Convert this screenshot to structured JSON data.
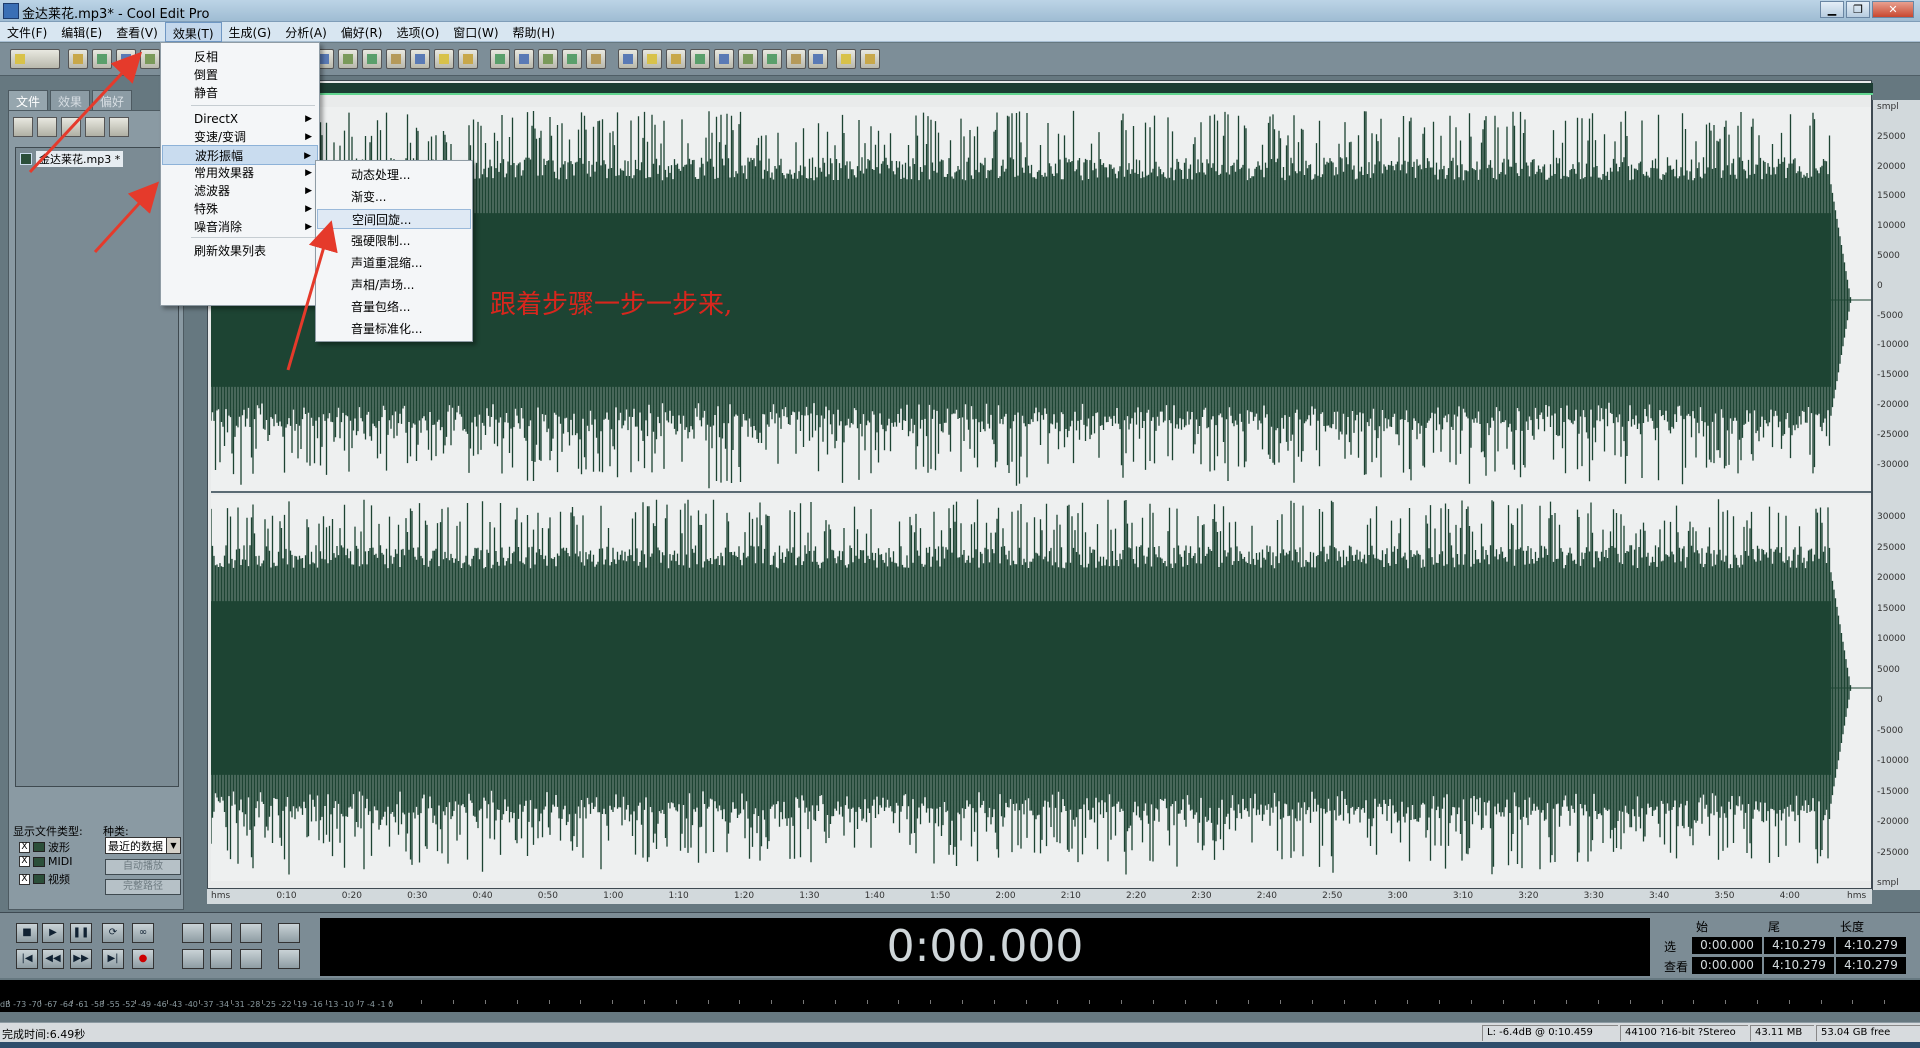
{
  "window": {
    "title": "金达莱花.mp3* - Cool Edit Pro",
    "controls": [
      "▁",
      "❐",
      "✕"
    ]
  },
  "menubar": [
    "文件(F)",
    "编辑(E)",
    "查看(V)",
    "效果(T)",
    "生成(G)",
    "分析(A)",
    "偏好(R)",
    "选项(O)",
    "窗口(W)",
    "帮助(H)"
  ],
  "left": {
    "tabs": [
      "文件",
      "效果",
      "偏好"
    ],
    "file": "金达莱花.mp3 *",
    "types_label": "显示文件类型:",
    "sort_label": "种类:",
    "types": [
      {
        "mark": "X",
        "label": "波形"
      },
      {
        "mark": "X",
        "label": "MIDI"
      },
      {
        "mark": "X",
        "label": "视频"
      }
    ],
    "sort_value": "最近的数据",
    "btn_autoplay": "自动播放",
    "btn_fullpath": "完整路径"
  },
  "effects_menu": {
    "items": [
      "反相",
      "倒置",
      "静音",
      "DirectX",
      "变速/变调",
      "波形振幅",
      "常用效果器",
      "滤波器",
      "特殊",
      "噪音消除",
      "刷新效果列表"
    ],
    "submenu_arrows": "▶"
  },
  "submenu": {
    "items": [
      "动态处理...",
      "渐变...",
      "空间回旋...",
      "强硬限制...",
      "声道重混缩...",
      "声相/声场...",
      "音量包络...",
      "音量标准化..."
    ]
  },
  "annotation": "跟着步骤一步一步来,",
  "ruler": {
    "labels": [
      "hms",
      "0:10",
      "0:20",
      "0:30",
      "0:40",
      "0:50",
      "1:00",
      "1:10",
      "1:20",
      "1:30",
      "1:40",
      "1:50",
      "2:00",
      "2:10",
      "2:20",
      "2:30",
      "2:40",
      "2:50",
      "3:00",
      "3:10",
      "3:20",
      "3:30",
      "3:40",
      "3:50",
      "4:00",
      "hms"
    ]
  },
  "yaxis": {
    "top": [
      "smpl",
      "25000",
      "20000",
      "15000",
      "10000",
      "5000",
      "0",
      "-5000",
      "-10000",
      "-15000",
      "-20000",
      "-25000",
      "-30000"
    ],
    "bottom": [
      "30000",
      "25000",
      "20000",
      "15000",
      "10000",
      "5000",
      "0",
      "-5000",
      "-10000",
      "-15000",
      "-20000",
      "-25000",
      "smpl"
    ]
  },
  "time_display": "0:00.000",
  "selection": {
    "h_begin": "始",
    "h_end": "尾",
    "h_len": "长度",
    "row_sel": "选",
    "row_view": "查看",
    "sel_begin": "0:00.000",
    "sel_end": "4:10.279",
    "sel_len": "4:10.279",
    "view_begin": "0:00.000",
    "view_end": "4:10.279",
    "view_len": "4:10.279"
  },
  "level_scale": "dB -73 -70 -67 -64 -61 -58 -55 -52 -49 -46 -43 -40 -37 -34 -31 -28 -25 -22 -19 -16 -13 -10 -7 -4 -1 0",
  "status": {
    "text": "完成时间:6.49秒",
    "level": "L: -6.4dB @ 0:10.459",
    "format": "44100 ?16-bit ?Stereo",
    "size": "43.11 MB",
    "free": "53.04 GB free"
  },
  "transport": {
    "stop": "■",
    "play": "▶",
    "pause": "❚❚",
    "playloop": "⟳",
    "loop": "∞",
    "rew_start": "|◀",
    "rew": "◀◀",
    "ff": "▶▶",
    "ff_end": "▶|",
    "record": "●"
  }
}
